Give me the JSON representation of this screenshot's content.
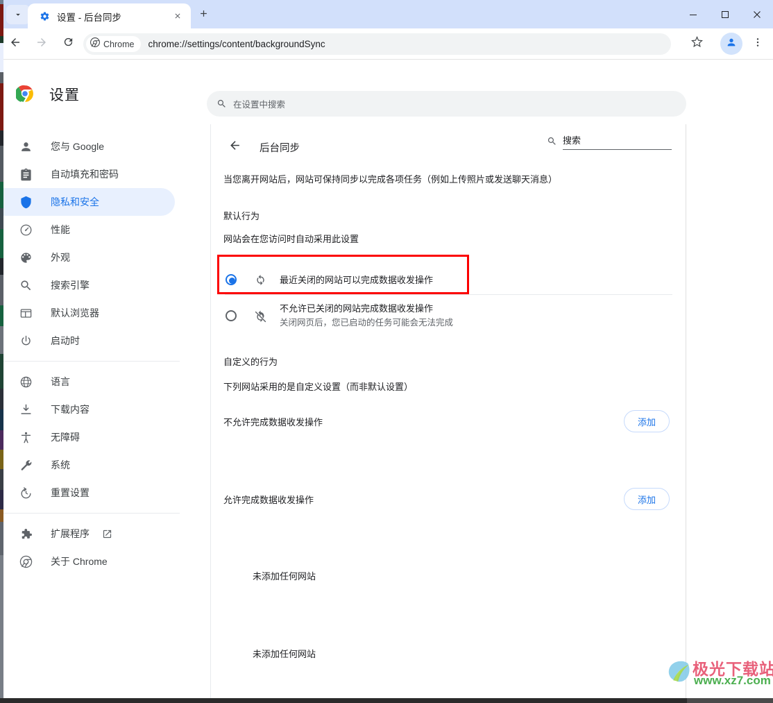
{
  "window": {
    "minimize_label": "minimize",
    "maximize_label": "maximize",
    "close_label": "close"
  },
  "tabstrip": {
    "tab_search_icon": "chevron-down-icon",
    "tab": {
      "favicon": "settings-gear-icon",
      "title": "设置 - 后台同步",
      "close_icon": "close-icon"
    },
    "new_tab_icon": "plus-icon"
  },
  "toolbar": {
    "back_icon": "arrow-back-icon",
    "forward_icon": "arrow-forward-icon",
    "reload_icon": "reload-icon",
    "chip_label": "Chrome",
    "chip_icon": "chrome-logo-icon",
    "url": "chrome://settings/content/backgroundSync",
    "bookmark_icon": "star-icon",
    "profile_icon": "avatar-icon",
    "menu_icon": "more-vertical-icon"
  },
  "settings_header": {
    "logo_icon": "chrome-logo-icon",
    "title": "设置",
    "search": {
      "icon": "search-icon",
      "placeholder": "在设置中搜索",
      "value": ""
    }
  },
  "sidebar": {
    "groups": [
      {
        "items": [
          {
            "icon": "person-icon",
            "label": "您与 Google",
            "active": false
          },
          {
            "icon": "autofill-icon",
            "label": "自动填充和密码",
            "active": false
          },
          {
            "icon": "shield-icon",
            "label": "隐私和安全",
            "active": true
          },
          {
            "icon": "performance-icon",
            "label": "性能",
            "active": false
          },
          {
            "icon": "palette-icon",
            "label": "外观",
            "active": false
          },
          {
            "icon": "search-icon",
            "label": "搜索引擎",
            "active": false
          },
          {
            "icon": "browser-icon",
            "label": "默认浏览器",
            "active": false
          },
          {
            "icon": "power-icon",
            "label": "启动时",
            "active": false
          }
        ]
      },
      {
        "items": [
          {
            "icon": "globe-icon",
            "label": "语言",
            "active": false
          },
          {
            "icon": "download-icon",
            "label": "下载内容",
            "active": false
          },
          {
            "icon": "accessibility-icon",
            "label": "无障碍",
            "active": false
          },
          {
            "icon": "wrench-icon",
            "label": "系统",
            "active": false
          },
          {
            "icon": "restore-icon",
            "label": "重置设置",
            "active": false
          }
        ]
      },
      {
        "items": [
          {
            "icon": "puzzle-icon",
            "label": "扩展程序",
            "active": false,
            "external": true
          },
          {
            "icon": "chrome-logo-icon",
            "label": "关于 Chrome",
            "active": false
          }
        ]
      }
    ]
  },
  "main": {
    "back_icon": "arrow-back-icon",
    "page_title": "后台同步",
    "search": {
      "icon": "search-icon",
      "placeholder": "搜索",
      "value": ""
    },
    "description": "当您离开网站后，网站可保持同步以完成各项任务（例如上传照片或发送聊天消息）",
    "default_behavior": {
      "heading": "默认行为",
      "subheading": "网站会在您访问时自动采用此设置",
      "options": [
        {
          "selected": true,
          "icon": "sync-icon",
          "label": "最近关闭的网站可以完成数据收发操作",
          "sublabel": ""
        },
        {
          "selected": false,
          "icon": "sync-disabled-icon",
          "label": "不允许已关闭的网站完成数据收发操作",
          "sublabel": "关闭网页后，您已启动的任务可能会无法完成"
        }
      ]
    },
    "custom_behavior": {
      "heading": "自定义的行为",
      "subheading": "下列网站采用的是自定义设置（而非默认设置）",
      "blocks": [
        {
          "label": "不允许完成数据收发操作",
          "add_label": "添加",
          "empty_text": "未添加任何网站"
        },
        {
          "label": "允许完成数据收发操作",
          "add_label": "添加",
          "empty_text": "未添加任何网站"
        }
      ]
    }
  },
  "highlight": {
    "color": "#fc0000",
    "target": "最近关闭的网站可以完成数据收发操作"
  },
  "watermark": {
    "line1": "极光下载站",
    "line2": "www.xz7.com"
  }
}
